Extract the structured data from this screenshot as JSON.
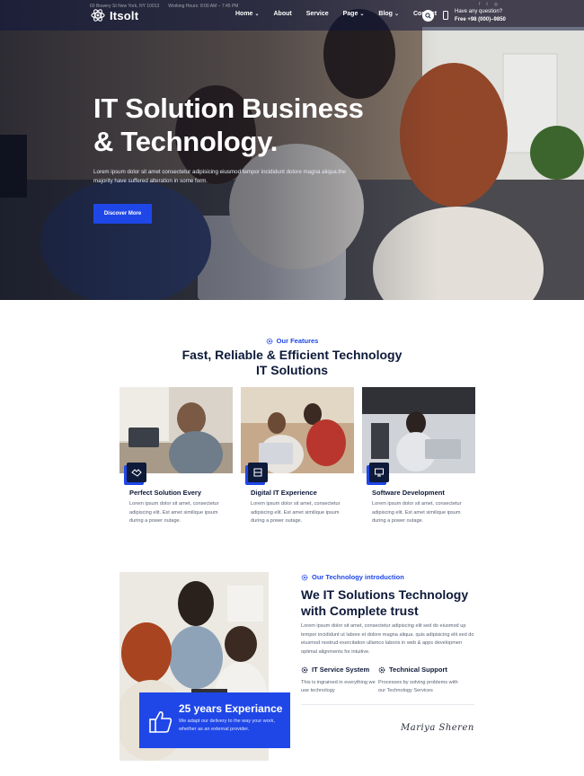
{
  "topbar": {
    "address": "60 Bowery St New York, NY 10013",
    "hours": "Working Hours: 8:00 AM – 7:45 PM",
    "social_icons": [
      "facebook-icon",
      "twitter-icon",
      "instagram-icon"
    ]
  },
  "brand": {
    "name": "Itsolt"
  },
  "nav": {
    "items": [
      {
        "label": "Home",
        "has_dropdown": true
      },
      {
        "label": "About",
        "has_dropdown": false
      },
      {
        "label": "Service",
        "has_dropdown": false
      },
      {
        "label": "Page",
        "has_dropdown": true
      },
      {
        "label": "Blog",
        "has_dropdown": true
      },
      {
        "label": "Contact",
        "has_dropdown": false
      }
    ]
  },
  "contact": {
    "question": "Have any question?",
    "phone": "Free +98 (000)–9850"
  },
  "hero": {
    "title_line1": "IT Solution Business",
    "title_line2": "& Technology.",
    "description": "Lorem ipsum dolor sit amet consectetur adipisicing eiusmod tempor incididunt dolore magna aliqua.the majority have suffered alteration in some form.",
    "button_label": "Discover More"
  },
  "features": {
    "tag": "Our Features",
    "title_line1": "Fast, Reliable & Efficient Technology",
    "title_line2": "IT Solutions",
    "cards": [
      {
        "title": "Perfect Solution Every",
        "text": "Lorem ipsum dolor sit amet, consectetur adipiscing elit. Est amet similique ipsum during a power outage.",
        "icon": "handshake-icon"
      },
      {
        "title": "Digital IT Experience",
        "text": "Lorem ipsum dolor sit amet, consectetur adipiscing elit. Est amet similique ipsum during a power outage.",
        "icon": "server-icon"
      },
      {
        "title": "Software Development",
        "text": "Lorem ipsum dolor sit amet, consectetur adipiscing elit. Est amet similique ipsum during a power outage.",
        "icon": "monitor-icon"
      }
    ]
  },
  "intro": {
    "tag": "Our Technology introduction",
    "title_line1": "We IT Solutions Technology",
    "title_line2": "with Complete trust",
    "description": "Lorem ipsum dolor sit amet, consectetur adipiscing elit sed do eiusmod up tempor incididunt ut labore et dolore magna aliqua. quis adipisicing elit sed do eiusmod nostrud exercitation ullamco laboris in web & apps developmen optimal alignments for intuitive.",
    "services": [
      {
        "title": "IT Service System",
        "text": "This is ingrained in everything we use technology"
      },
      {
        "title": "Technical Support",
        "text": "Processes by solving problems with our Technology Services"
      }
    ],
    "experience_title": "25 years Experiance",
    "experience_text": "We adapt our delivery to the way your work, whether as an external provider.",
    "signature": "Mariya Sheren"
  },
  "colors": {
    "accent": "#1f47e8",
    "navy": "#0e1a3a",
    "body_text": "#5b6275"
  }
}
